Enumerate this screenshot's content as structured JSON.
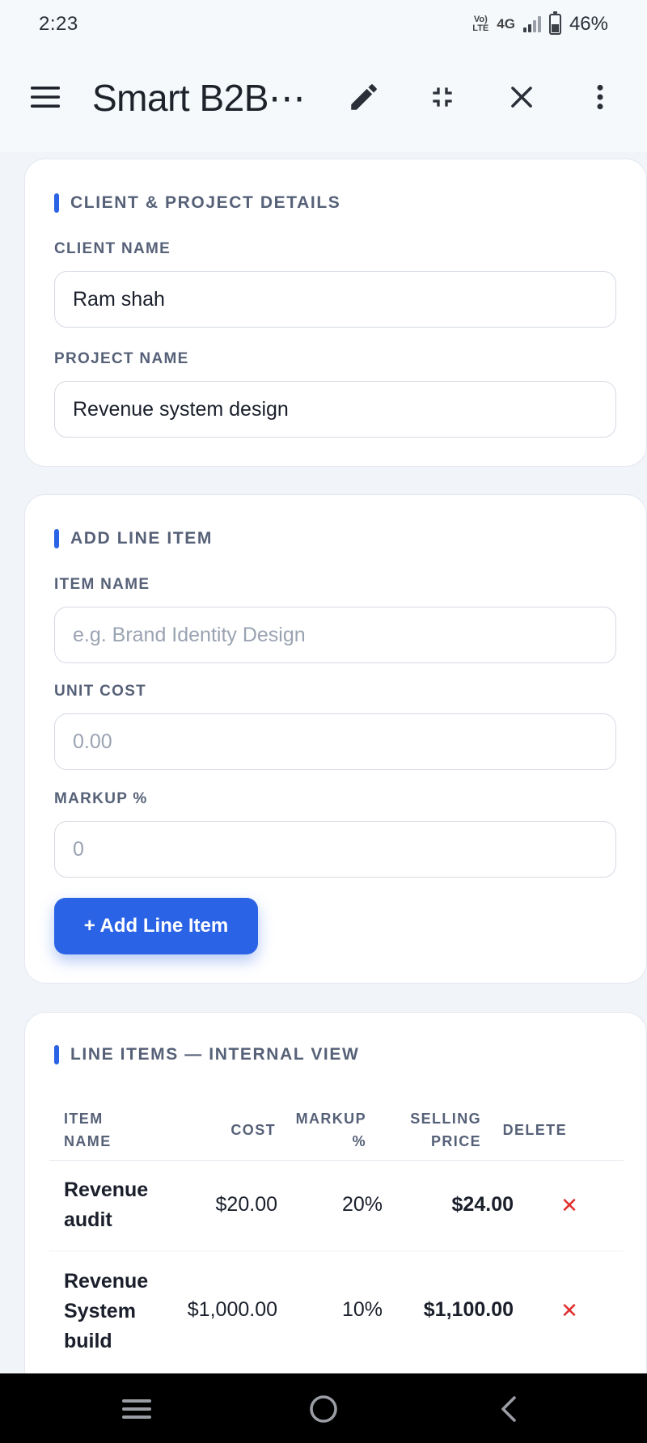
{
  "status_bar": {
    "time": "2:23",
    "volte_top": "Vo)",
    "volte_bottom": "LTE",
    "network": "4G",
    "battery": "46%",
    "battery_level": 0.46
  },
  "app_bar": {
    "title": "Smart B2B⋯",
    "icons": [
      "menu-icon",
      "edit-icon",
      "collapse-icon",
      "close-icon",
      "more-vert-icon"
    ]
  },
  "client_section": {
    "title": "CLIENT & PROJECT DETAILS",
    "client_label": "CLIENT NAME",
    "client_value": "Ram shah",
    "project_label": "PROJECT NAME",
    "project_value": "Revenue system design"
  },
  "add_section": {
    "title": "ADD LINE ITEM",
    "item_label": "ITEM NAME",
    "item_placeholder": "e.g. Brand Identity Design",
    "cost_label": "UNIT COST",
    "cost_placeholder": "0.00",
    "markup_label": "MARKUP %",
    "markup_placeholder": "0",
    "button_label": "+ Add Line Item"
  },
  "items_section": {
    "title": "LINE ITEMS — INTERNAL VIEW",
    "columns": {
      "item_name": [
        "ITEM",
        "NAME"
      ],
      "cost": "COST",
      "markup": [
        "MARKUP",
        "%"
      ],
      "selling": [
        "SELLING",
        "PRICE"
      ],
      "delete": "DELETE"
    },
    "rows": [
      {
        "name": [
          "Revenue",
          "audit"
        ],
        "cost": "$20.00",
        "markup": "20%",
        "selling": "$24.00",
        "delete": "✕"
      },
      {
        "name": [
          "Revenue",
          "System",
          "build"
        ],
        "cost": "$1,000.00",
        "markup": "10%",
        "selling": "$1,100.00",
        "delete": "✕"
      }
    ]
  },
  "colors": {
    "accent": "#2a63e6",
    "delete": "#e0302f",
    "label": "#566178",
    "background": "#f1f4f8"
  },
  "nav_bar": {
    "icons": [
      "recents-icon",
      "home-icon",
      "back-icon"
    ]
  }
}
